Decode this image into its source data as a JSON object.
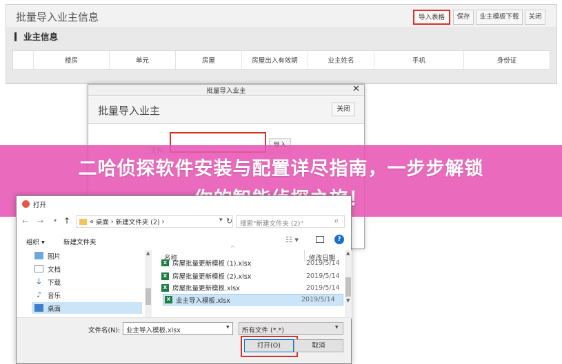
{
  "main": {
    "title": "批量导入业主信息",
    "toolbar": {
      "import_table": "导入表格",
      "save": "保存",
      "template_download": "业主模板下载",
      "close": "关闭"
    },
    "section_title": "业主信息",
    "columns": [
      "",
      "楼房",
      "单元",
      "房屋",
      "房屋出入有效期",
      "业主姓名",
      "手机",
      "身份证"
    ]
  },
  "import_dialog": {
    "caption": "批量导入业主",
    "close_x": "✕",
    "title": "批量导入业主",
    "close_button": "关闭",
    "file_label": "文件",
    "import_button": "导入"
  },
  "banner": {
    "line1": "二哈侦探软件安装与配置详尽指南，一步步解锁",
    "line2": "你的智能侦探之旅！"
  },
  "file_dialog": {
    "title": "打开",
    "breadcrumb": [
      "«",
      "桌面",
      "›",
      "新建文件夹 (2)",
      "›"
    ],
    "search_placeholder": "搜索\"新建文件夹 (2)\"",
    "organize": "组织 ▾",
    "new_folder": "新建文件夹",
    "nav_items": [
      {
        "label": "图片",
        "icon": "pictures-icon"
      },
      {
        "label": "文档",
        "icon": "documents-icon"
      },
      {
        "label": "下载",
        "icon": "downloads-icon"
      },
      {
        "label": "音乐",
        "icon": "music-icon"
      },
      {
        "label": "桌面",
        "icon": "desktop-icon"
      }
    ],
    "col_name": "名称",
    "col_date": "修改日期",
    "files": [
      {
        "name": "房屋批量更新模板 (1).xlsx",
        "date": "2019/5/14"
      },
      {
        "name": "房屋批量更新模板 (2).xlsx",
        "date": "2019/5/14"
      },
      {
        "name": "房屋批量更新模板.xlsx",
        "date": "2019/5/14"
      },
      {
        "name": "业主导入模板.xlsx",
        "date": "2019/5/14"
      }
    ],
    "filename_label": "文件名(N):",
    "filename_value": "业主导入模板.xlsx",
    "filetype": "所有文件 (*.*)",
    "open_button": "打开(O)",
    "cancel_button": "取消"
  },
  "colors": {
    "highlight_red": "#d9302a",
    "banner_pink": "#e756b4",
    "excel_green": "#1e7c45"
  }
}
